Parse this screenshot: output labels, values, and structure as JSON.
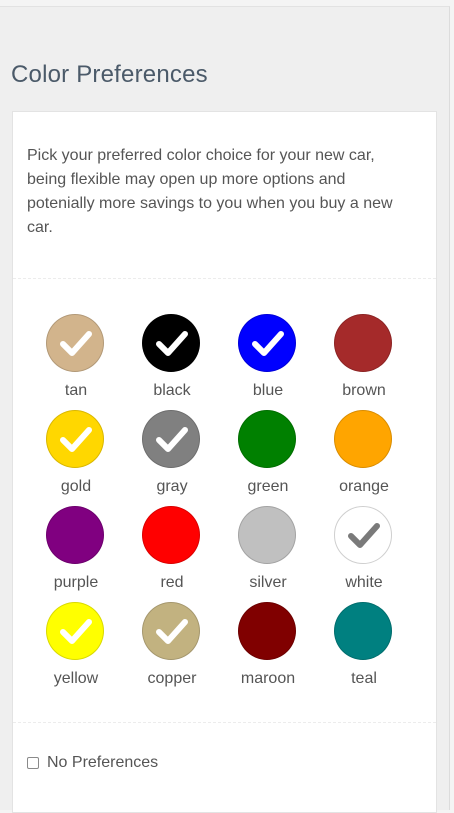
{
  "title": "Color Preferences",
  "description": "Pick your preferred color choice for your new car, being flexible may open up more options and potenially more savings to you when you buy a new car.",
  "colors": [
    {
      "name": "tan",
      "hex": "#d2b48c",
      "selected": true
    },
    {
      "name": "black",
      "hex": "#000000",
      "selected": true
    },
    {
      "name": "blue",
      "hex": "#0000ff",
      "selected": true
    },
    {
      "name": "brown",
      "hex": "#a52a2a",
      "selected": false
    },
    {
      "name": "gold",
      "hex": "#ffd700",
      "selected": true
    },
    {
      "name": "gray",
      "hex": "#808080",
      "selected": true
    },
    {
      "name": "green",
      "hex": "#008000",
      "selected": false
    },
    {
      "name": "orange",
      "hex": "#ffa500",
      "selected": false
    },
    {
      "name": "purple",
      "hex": "#800080",
      "selected": false
    },
    {
      "name": "red",
      "hex": "#ff0000",
      "selected": false
    },
    {
      "name": "silver",
      "hex": "#c0c0c0",
      "selected": false
    },
    {
      "name": "white",
      "hex": "#ffffff",
      "selected": true
    },
    {
      "name": "yellow",
      "hex": "#ffff00",
      "selected": true
    },
    {
      "name": "copper",
      "hex": "#c2b280",
      "selected": true
    },
    {
      "name": "maroon",
      "hex": "#800000",
      "selected": false
    },
    {
      "name": "teal",
      "hex": "#008080",
      "selected": false
    }
  ],
  "check_color_default": "#ffffff",
  "check_color_on_white": "#7a7a7a",
  "no_preferences": {
    "label": "No Preferences",
    "checked": false
  }
}
